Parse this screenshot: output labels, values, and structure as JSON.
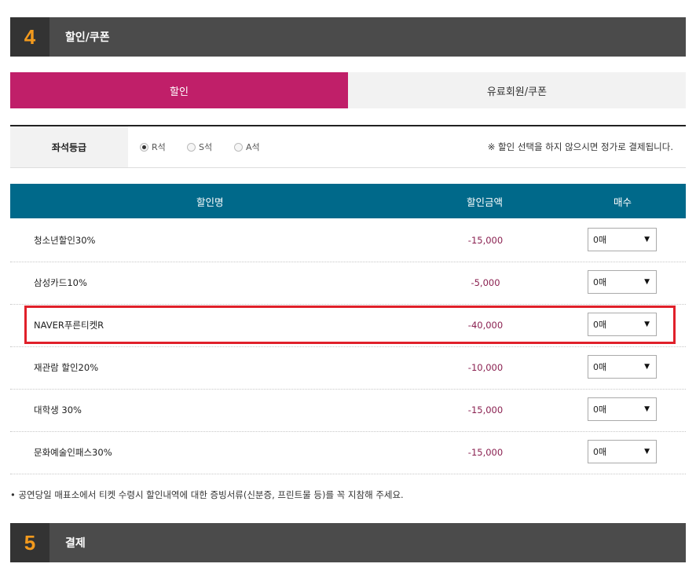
{
  "step4": {
    "number": "4",
    "title": "할인/쿠폰"
  },
  "tabs": [
    {
      "label": "할인",
      "active": true
    },
    {
      "label": "유료회원/쿠폰",
      "active": false
    }
  ],
  "seat_grade": {
    "label": "좌석등급",
    "options": [
      {
        "label": "R석",
        "selected": true
      },
      {
        "label": "S석",
        "selected": false
      },
      {
        "label": "A석",
        "selected": false
      }
    ],
    "notice": "※ 할인 선택을 하지 않으시면 정가로 결제됩니다."
  },
  "table": {
    "headers": {
      "name": "할인명",
      "amount": "할인금액",
      "count": "매수"
    },
    "rows": [
      {
        "name": "청소년할인30%",
        "amount": "-15,000",
        "count": "0매"
      },
      {
        "name": "삼성카드10%",
        "amount": "-5,000",
        "count": "0매"
      },
      {
        "name": "NAVER푸른티켓R",
        "amount": "-40,000",
        "count": "0매"
      },
      {
        "name": "재관람 할인20%",
        "amount": "-10,000",
        "count": "0매"
      },
      {
        "name": "대학생 30%",
        "amount": "-15,000",
        "count": "0매"
      },
      {
        "name": "문화예술인패스30%",
        "amount": "-15,000",
        "count": "0매"
      }
    ]
  },
  "footnote": "• 공연당일 매표소에서 티켓 수령시 할인내역에 대한 증빙서류(신분증, 프린트물 등)를 꼭 지참해 주세요.",
  "step5": {
    "number": "5",
    "title": "결제"
  },
  "colors": {
    "accent": "#c01f69",
    "table_header": "#00698a",
    "step_number": "#f39a1d",
    "highlight": "#e0202a"
  },
  "icons": {
    "select_caret": "caret-down-icon"
  }
}
